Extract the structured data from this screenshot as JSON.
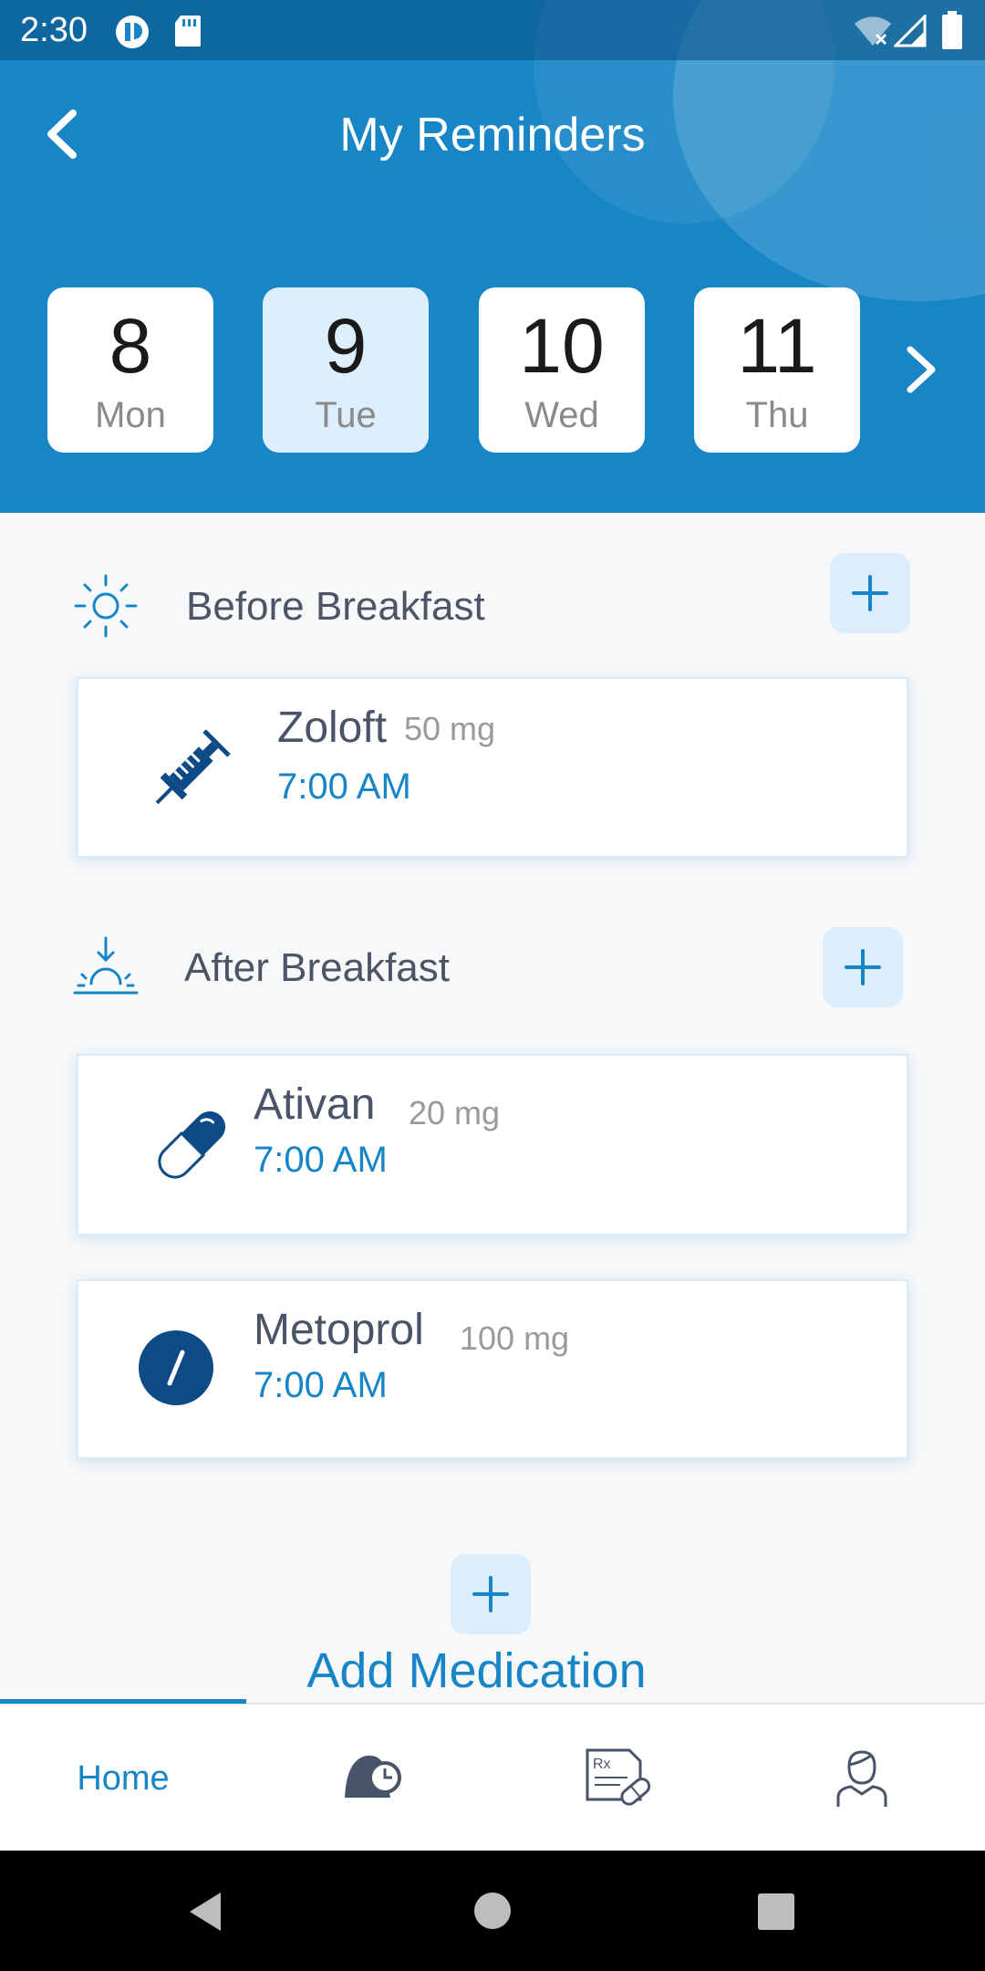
{
  "status_bar": {
    "time": "2:30"
  },
  "header": {
    "title": "My Reminders"
  },
  "days": [
    {
      "num": "8",
      "name": "Mon"
    },
    {
      "num": "9",
      "name": "Tue"
    },
    {
      "num": "10",
      "name": "Wed"
    },
    {
      "num": "11",
      "name": "Thu"
    }
  ],
  "selected_day": "9",
  "sections": [
    {
      "title": "Before Breakfast",
      "icon": "sun-icon",
      "meds": [
        {
          "name": "Zoloft",
          "dose": "50 mg",
          "time": "7:00 AM",
          "icon": "syringe-icon"
        }
      ]
    },
    {
      "title": "After Breakfast",
      "icon": "sunrise-icon",
      "meds": [
        {
          "name": "Ativan",
          "dose": "20 mg",
          "time": "7:00 AM",
          "icon": "capsule-icon"
        },
        {
          "name": "Metoprol",
          "dose": "100 mg",
          "time": "7:00 AM",
          "icon": "tablet-icon"
        }
      ]
    }
  ],
  "add_medication": {
    "label": "Add Medication"
  },
  "bottom_nav": {
    "home_label": "Home",
    "items": [
      "home",
      "reminders-alarm-icon",
      "prescription-icon",
      "profile-icon"
    ],
    "active": "home"
  },
  "colors": {
    "primary": "#1886c6",
    "selected_day_bg": "#ddeefc",
    "icon_navy": "#0e4a86"
  }
}
